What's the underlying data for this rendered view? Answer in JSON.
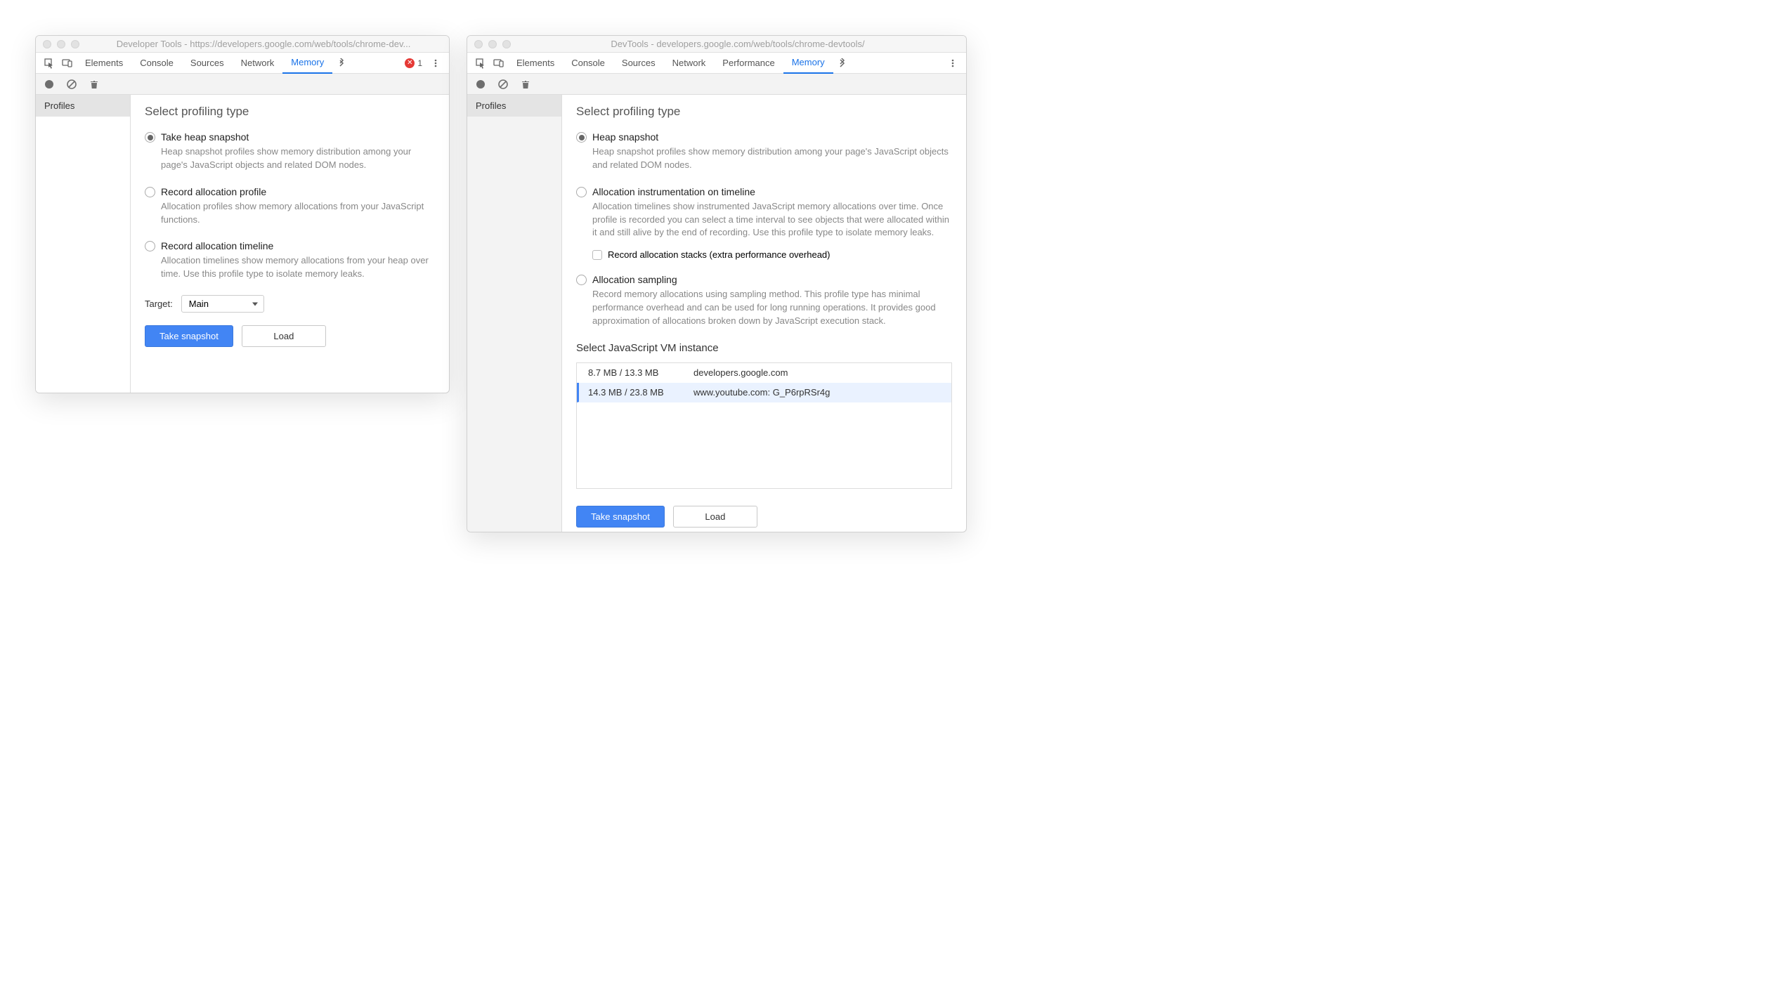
{
  "left": {
    "title": "Developer Tools - https://developers.google.com/web/tools/chrome-dev...",
    "tabs": [
      "Elements",
      "Console",
      "Sources",
      "Network",
      "Memory"
    ],
    "active_tab": "Memory",
    "error_count": "1",
    "sidebar": {
      "item": "Profiles"
    },
    "heading": "Select profiling type",
    "options": [
      {
        "label": "Take heap snapshot",
        "checked": true,
        "desc": "Heap snapshot profiles show memory distribution among your page's JavaScript objects and related DOM nodes."
      },
      {
        "label": "Record allocation profile",
        "checked": false,
        "desc": "Allocation profiles show memory allocations from your JavaScript functions."
      },
      {
        "label": "Record allocation timeline",
        "checked": false,
        "desc": "Allocation timelines show memory allocations from your heap over time. Use this profile type to isolate memory leaks."
      }
    ],
    "target_label": "Target:",
    "target_value": "Main",
    "buttons": {
      "primary": "Take snapshot",
      "secondary": "Load"
    }
  },
  "right": {
    "title": "DevTools - developers.google.com/web/tools/chrome-devtools/",
    "tabs": [
      "Elements",
      "Console",
      "Sources",
      "Network",
      "Performance",
      "Memory"
    ],
    "active_tab": "Memory",
    "sidebar": {
      "item": "Profiles"
    },
    "heading": "Select profiling type",
    "options": [
      {
        "label": "Heap snapshot",
        "checked": true,
        "desc": "Heap snapshot profiles show memory distribution among your page's JavaScript objects and related DOM nodes."
      },
      {
        "label": "Allocation instrumentation on timeline",
        "checked": false,
        "desc": "Allocation timelines show instrumented JavaScript memory allocations over time. Once profile is recorded you can select a time interval to see objects that were allocated within it and still alive by the end of recording. Use this profile type to isolate memory leaks.",
        "checkbox_label": "Record allocation stacks (extra performance overhead)"
      },
      {
        "label": "Allocation sampling",
        "checked": false,
        "desc": "Record memory allocations using sampling method. This profile type has minimal performance overhead and can be used for long running operations. It provides good approximation of allocations broken down by JavaScript execution stack."
      }
    ],
    "vm_heading": "Select JavaScript VM instance",
    "vm_instances": [
      {
        "size": "8.7 MB / 13.3 MB",
        "host": "developers.google.com",
        "selected": false
      },
      {
        "size": "14.3 MB / 23.8 MB",
        "host": "www.youtube.com: G_P6rpRSr4g",
        "selected": true
      }
    ],
    "buttons": {
      "primary": "Take snapshot",
      "secondary": "Load"
    }
  }
}
